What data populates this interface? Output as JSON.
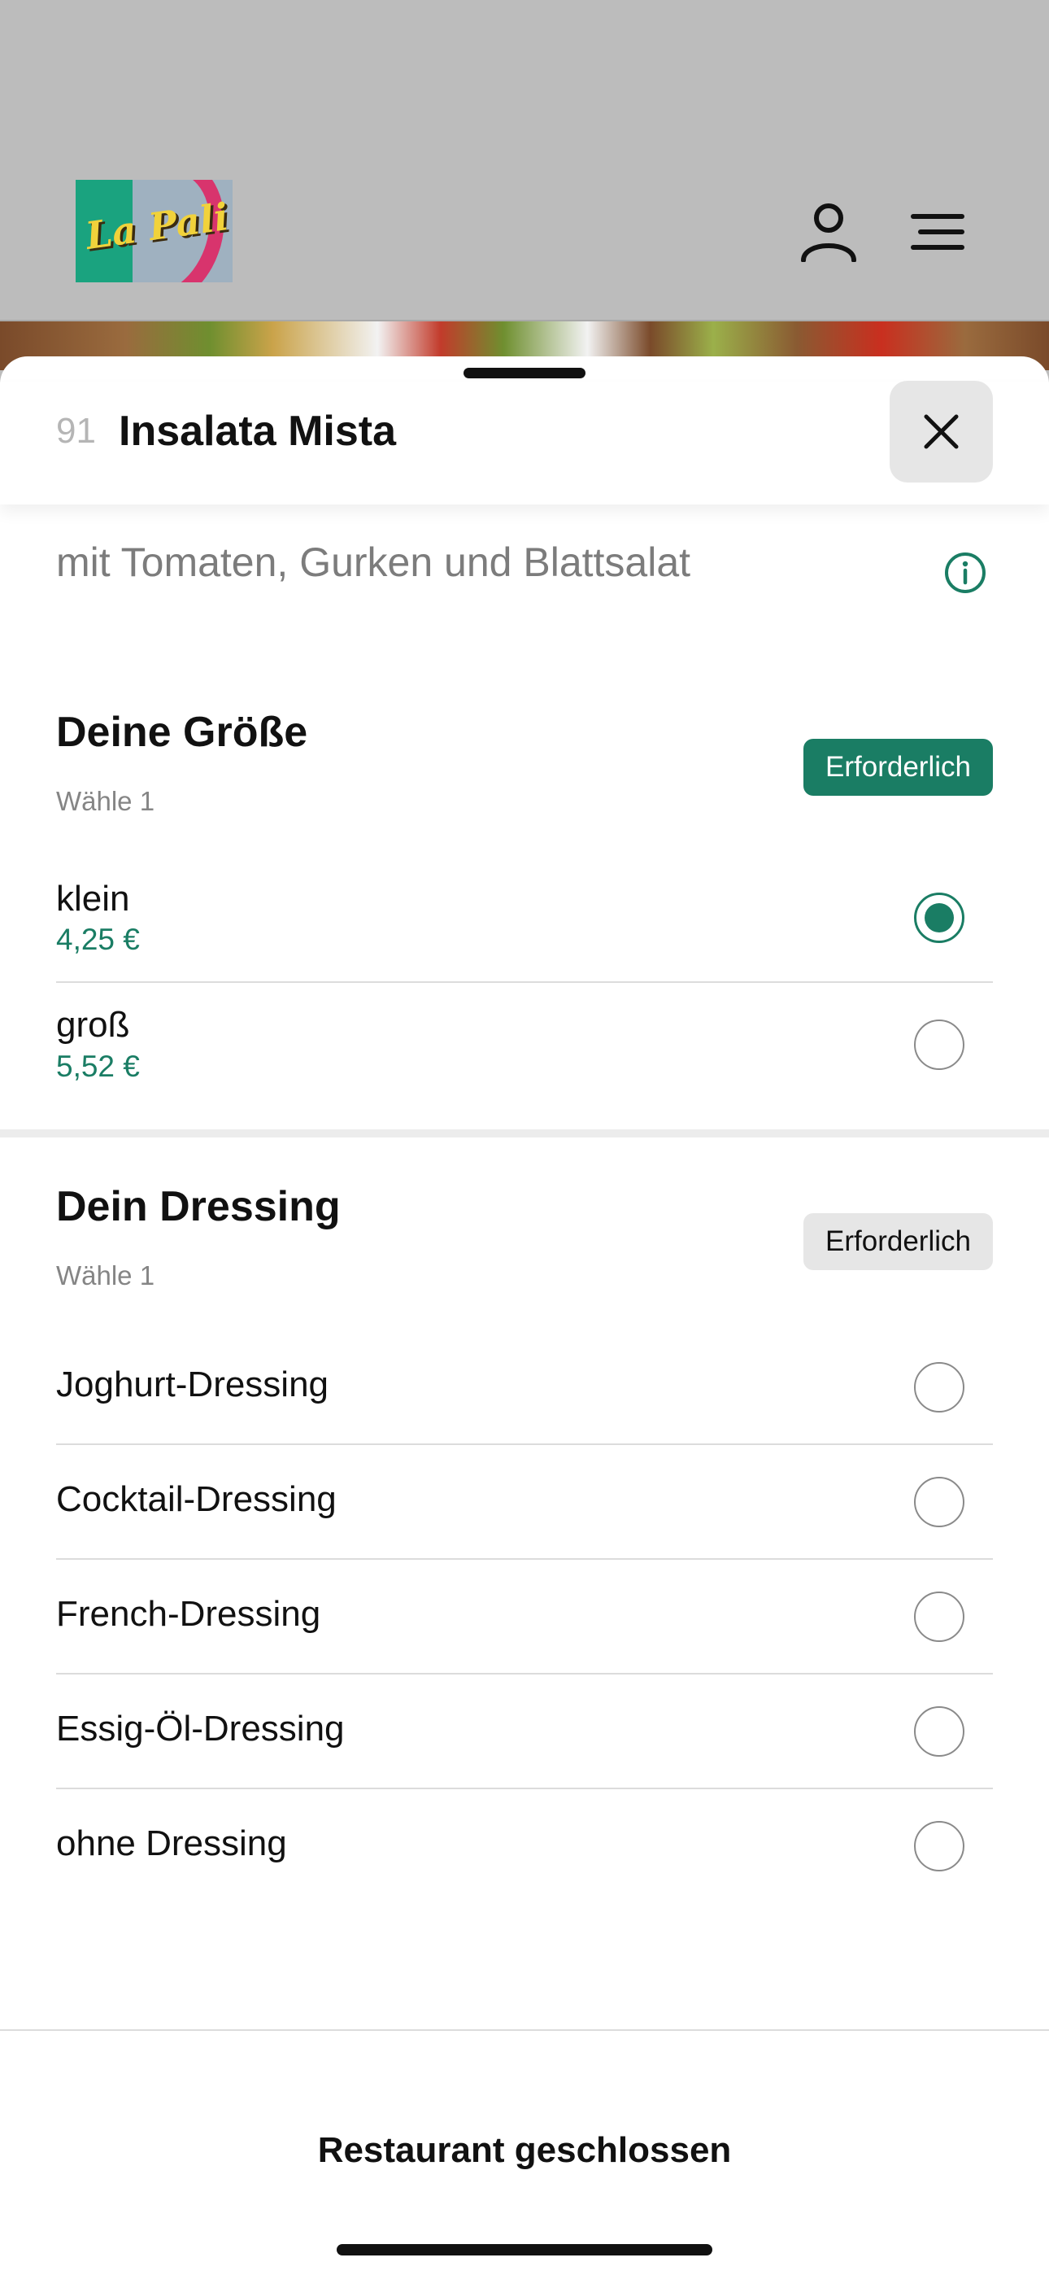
{
  "header": {
    "logo_text": "La Pali"
  },
  "item": {
    "number": "91",
    "title": "Insalata Mista",
    "description": "mit Tomaten, Gurken und Blattsalat"
  },
  "sections": [
    {
      "title": "Deine Größe",
      "subtitle": "Wähle 1",
      "badge": "Erforderlich",
      "options": [
        {
          "name": "klein",
          "price": "4,25 €",
          "selected": true
        },
        {
          "name": "groß",
          "price": "5,52 €",
          "selected": false
        }
      ]
    },
    {
      "title": "Dein Dressing",
      "subtitle": "Wähle 1",
      "badge": "Erforderlich",
      "options": [
        {
          "name": "Joghurt-Dressing",
          "selected": false
        },
        {
          "name": "Cocktail-Dressing",
          "selected": false
        },
        {
          "name": "French-Dressing",
          "selected": false
        },
        {
          "name": "Essig-Öl-Dressing",
          "selected": false
        },
        {
          "name": "ohne Dressing",
          "selected": false
        }
      ]
    }
  ],
  "footer": {
    "status": "Restaurant geschlossen"
  },
  "colors": {
    "accent": "#1a7d64",
    "badge_muted": "#e6e6e6",
    "overlay": "#bcbcbc"
  },
  "icons": [
    "user-icon",
    "menu-icon",
    "close-icon",
    "info-icon"
  ]
}
